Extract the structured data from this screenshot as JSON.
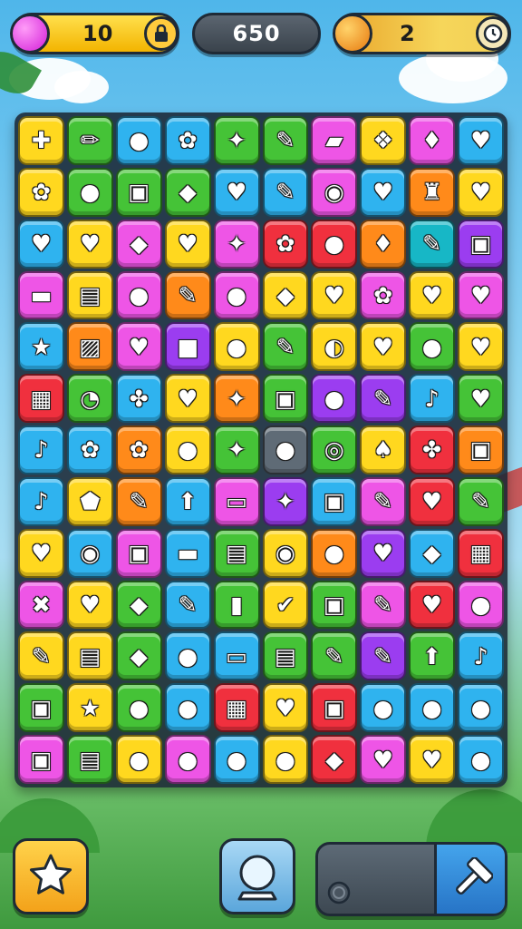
{
  "hud": {
    "lives": {
      "value": "10",
      "orb_color": "#e03cf0",
      "icon": "lock-icon"
    },
    "score": {
      "value": "650"
    },
    "moves": {
      "value": "2",
      "orb_color": "#f5a524",
      "icon": "clock-icon"
    }
  },
  "board": {
    "rows": 13,
    "cols": 9,
    "palette": {
      "Y": "#ffd81f",
      "G": "#45c337",
      "B": "#2fb3ef",
      "P": "#ee55e6",
      "R": "#f0303e",
      "O": "#ff8a1a",
      "V": "#9b3df0",
      "T": "#17b7c6",
      "D": "#5f6b76"
    },
    "tiles": [
      [
        [
          "Y",
          "bandage-icon",
          "✚"
        ],
        [
          "G",
          "pencil-icon",
          "✏"
        ],
        [
          "B",
          "cookie-icon",
          "●"
        ],
        [
          "B",
          "gear-icon",
          "✿"
        ],
        [
          "G",
          "star-icon",
          "✦"
        ],
        [
          "G",
          "pencil-icon",
          "✎"
        ],
        [
          "P",
          "eraser-icon",
          "▰"
        ],
        [
          "Y",
          "puzzle-icon",
          "❖"
        ],
        [
          "P",
          "balloon-icon",
          "♦"
        ],
        [
          "B",
          "heart-icon",
          "♥"
        ]
      ],
      [
        [
          "Y",
          "gear-icon",
          "✿"
        ],
        [
          "G",
          "speech-bubble-icon",
          "●"
        ],
        [
          "G",
          "card-icon",
          "▣"
        ],
        [
          "G",
          "eraser-icon",
          "◆"
        ],
        [
          "B",
          "heart-icon",
          "♥"
        ],
        [
          "B",
          "paintbrush-icon",
          "✎"
        ],
        [
          "P",
          "magnifier-icon",
          "◉"
        ],
        [
          "B",
          "heart-icon",
          "♥"
        ],
        [
          "O",
          "castle-icon",
          "♜"
        ],
        [
          "Y",
          "heart-icon",
          "♥"
        ]
      ],
      [
        [
          "B",
          "heart-icon",
          "♥"
        ],
        [
          "Y",
          "heart-icon",
          "♥"
        ],
        [
          "P",
          "eraser-icon",
          "◆"
        ],
        [
          "Y",
          "heart-icon",
          "♥"
        ],
        [
          "P",
          "star-icon",
          "✦"
        ],
        [
          "R",
          "gear-icon",
          "✿"
        ],
        [
          "R",
          "lollipop-icon",
          "●"
        ],
        [
          "O",
          "leaf-icon",
          "♦"
        ],
        [
          "T",
          "pencil-icon",
          "✎"
        ],
        [
          "V",
          "safe-icon",
          "▣"
        ]
      ],
      [
        [
          "P",
          "speech-bubble-icon",
          "▬"
        ],
        [
          "Y",
          "book-icon",
          "▤"
        ],
        [
          "P",
          "apple-icon",
          "●"
        ],
        [
          "O",
          "paintbrush-icon",
          "✎"
        ],
        [
          "P",
          "pig-icon",
          "●"
        ],
        [
          "Y",
          "eraser-icon",
          "◆"
        ],
        [
          "Y",
          "heart-icon",
          "♥"
        ],
        [
          "P",
          "gear-icon",
          "✿"
        ],
        [
          "Y",
          "heart-icon",
          "♥"
        ],
        [
          "P",
          "heart-icon",
          "♥"
        ]
      ],
      [
        [
          "B",
          "star-icon",
          "★"
        ],
        [
          "O",
          "frame-icon",
          "▨"
        ],
        [
          "P",
          "heart-icon",
          "♥"
        ],
        [
          "V",
          "square-icon",
          "■"
        ],
        [
          "Y",
          "cherry-icon",
          "●"
        ],
        [
          "G",
          "pencil-icon",
          "✎"
        ],
        [
          "Y",
          "lemon-icon",
          "◐"
        ],
        [
          "Y",
          "heart-icon",
          "♥"
        ],
        [
          "G",
          "cherry-icon",
          "●"
        ],
        [
          "Y",
          "heart-icon",
          "♥"
        ]
      ],
      [
        [
          "R",
          "grid-icon",
          "▦"
        ],
        [
          "G",
          "horseshoe-icon",
          "◔"
        ],
        [
          "B",
          "bow-icon",
          "✤"
        ],
        [
          "Y",
          "tooth-icon",
          "♥"
        ],
        [
          "O",
          "star-icon",
          "✦"
        ],
        [
          "G",
          "square-icon",
          "▣"
        ],
        [
          "V",
          "speech-bubble-icon",
          "●"
        ],
        [
          "V",
          "bone-icon",
          "✎"
        ],
        [
          "B",
          "sock-icon",
          "♪"
        ],
        [
          "G",
          "heart-icon",
          "♥"
        ]
      ],
      [
        [
          "B",
          "lollipop-icon",
          "♪"
        ],
        [
          "B",
          "gear-icon",
          "✿"
        ],
        [
          "O",
          "leaf-icon",
          "✿"
        ],
        [
          "Y",
          "apple-icon",
          "●"
        ],
        [
          "G",
          "star-icon",
          "✦"
        ],
        [
          "D",
          "apple-icon",
          "●"
        ],
        [
          "G",
          "swirl-icon",
          "◎"
        ],
        [
          "Y",
          "mushroom-icon",
          "♠"
        ],
        [
          "R",
          "bow-icon",
          "✤"
        ],
        [
          "O",
          "backpack-icon",
          "▣"
        ]
      ],
      [
        [
          "B",
          "sock-icon",
          "♪"
        ],
        [
          "Y",
          "shield-icon",
          "⬟"
        ],
        [
          "O",
          "pencil-icon",
          "✎"
        ],
        [
          "B",
          "arrow-up-icon",
          "⬆"
        ],
        [
          "P",
          "card-icon",
          "▭"
        ],
        [
          "V",
          "star-icon",
          "✦"
        ],
        [
          "B",
          "backpack-icon",
          "▣"
        ],
        [
          "P",
          "bone-icon",
          "✎"
        ],
        [
          "R",
          "heart-icon",
          "♥"
        ],
        [
          "G",
          "paintbrush-icon",
          "✎"
        ]
      ],
      [
        [
          "Y",
          "heart-icon",
          "♥"
        ],
        [
          "B",
          "ring-icon",
          "◉"
        ],
        [
          "P",
          "camera-icon",
          "▣"
        ],
        [
          "B",
          "speech-bubble-icon",
          "▬"
        ],
        [
          "G",
          "clipboard-icon",
          "▤"
        ],
        [
          "Y",
          "circle-icon",
          "◉"
        ],
        [
          "O",
          "balloon-icon",
          "●"
        ],
        [
          "V",
          "heart-icon",
          "♥"
        ],
        [
          "B",
          "banana-icon",
          "◆"
        ],
        [
          "R",
          "grid-icon",
          "▦"
        ]
      ],
      [
        [
          "P",
          "cross-icon",
          "✖"
        ],
        [
          "Y",
          "heart-icon",
          "♥"
        ],
        [
          "G",
          "eraser-icon",
          "◆"
        ],
        [
          "B",
          "paintbrush-icon",
          "✎"
        ],
        [
          "G",
          "bottle-icon",
          "▮"
        ],
        [
          "Y",
          "check-icon",
          "✔"
        ],
        [
          "G",
          "square-icon",
          "▣"
        ],
        [
          "P",
          "bone-icon",
          "✎"
        ],
        [
          "R",
          "heart-icon",
          "♥"
        ],
        [
          "P",
          "potion-icon",
          "●"
        ]
      ],
      [
        [
          "Y",
          "lollipop-icon",
          "✎"
        ],
        [
          "Y",
          "basket-icon",
          "▤"
        ],
        [
          "G",
          "bandage-icon",
          "◆"
        ],
        [
          "B",
          "circle-icon",
          "●"
        ],
        [
          "B",
          "scroll-icon",
          "▭"
        ],
        [
          "G",
          "basket-icon",
          "▤"
        ],
        [
          "G",
          "shovel-icon",
          "✎"
        ],
        [
          "V",
          "wrench-icon",
          "✎"
        ],
        [
          "G",
          "arrow-up-icon",
          "⬆"
        ],
        [
          "B",
          "key-icon",
          "♪"
        ]
      ],
      [
        [
          "G",
          "bag-icon",
          "▣"
        ],
        [
          "Y",
          "star-icon",
          "★"
        ],
        [
          "G",
          "apple-icon",
          "●"
        ],
        [
          "B",
          "lollipop-icon",
          "●"
        ],
        [
          "R",
          "grid-icon",
          "▦"
        ],
        [
          "Y",
          "heart-icon",
          "♥"
        ],
        [
          "R",
          "backpack-icon",
          "▣"
        ],
        [
          "B",
          "cherry-icon",
          "●"
        ],
        [
          "B",
          "orange-icon",
          "●"
        ],
        [
          "B",
          "lemon-icon",
          "●"
        ]
      ],
      [
        [
          "P",
          "cube-icon",
          "▣"
        ],
        [
          "G",
          "box-icon",
          "▤"
        ],
        [
          "Y",
          "orange-icon",
          "●"
        ],
        [
          "P",
          "circle-icon",
          "●"
        ],
        [
          "B",
          "apple-icon",
          "●"
        ],
        [
          "Y",
          "apple-icon",
          "●"
        ],
        [
          "R",
          "eraser-icon",
          "◆"
        ],
        [
          "P",
          "heart-icon",
          "♥"
        ],
        [
          "Y",
          "heart-icon",
          "♥"
        ],
        [
          "B",
          "speech-bubble-icon",
          "●"
        ]
      ]
    ]
  },
  "toolbar": {
    "star_icon": "star-booster-icon",
    "orb_icon": "crystal-ball-icon",
    "tray_icon": "coin-icon",
    "hammer_icon": "hammer-icon"
  }
}
